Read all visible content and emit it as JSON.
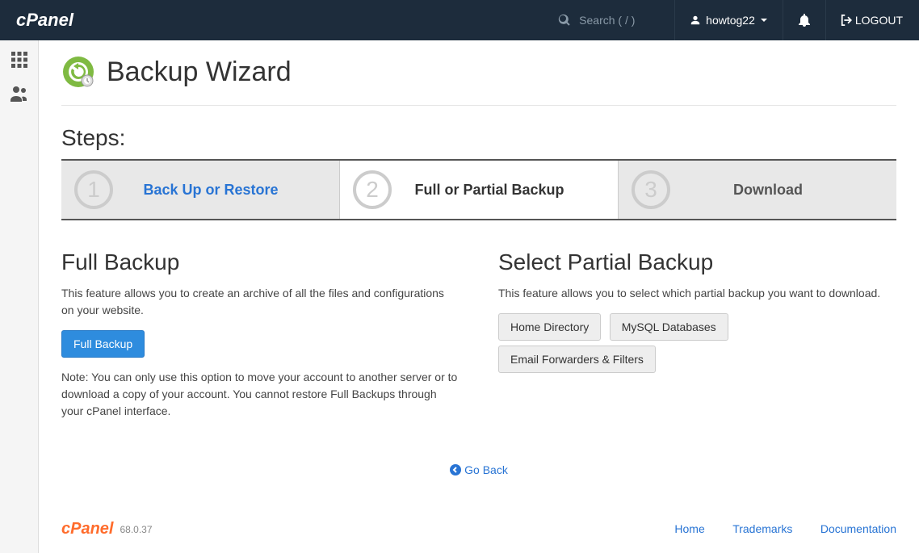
{
  "topbar": {
    "search_placeholder": "Search ( / )",
    "username": "howtog22",
    "logout": "LOGOUT"
  },
  "page": {
    "title": "Backup Wizard",
    "steps_label": "Steps:"
  },
  "steps": [
    {
      "num": "1",
      "label": "Back Up or Restore"
    },
    {
      "num": "2",
      "label": "Full or Partial Backup"
    },
    {
      "num": "3",
      "label": "Download"
    }
  ],
  "full_backup": {
    "heading": "Full Backup",
    "desc": "This feature allows you to create an archive of all the files and configurations on your website.",
    "button": "Full Backup",
    "note": "Note: You can only use this option to move your account to another server or to download a copy of your account. You cannot restore Full Backups through your cPanel interface."
  },
  "partial_backup": {
    "heading": "Select Partial Backup",
    "desc": "This feature allows you to select which partial backup you want to download.",
    "buttons": [
      "Home Directory",
      "MySQL Databases",
      "Email Forwarders & Filters"
    ]
  },
  "goback": "Go Back",
  "footer": {
    "version": "68.0.37",
    "links": [
      "Home",
      "Trademarks",
      "Documentation"
    ]
  }
}
